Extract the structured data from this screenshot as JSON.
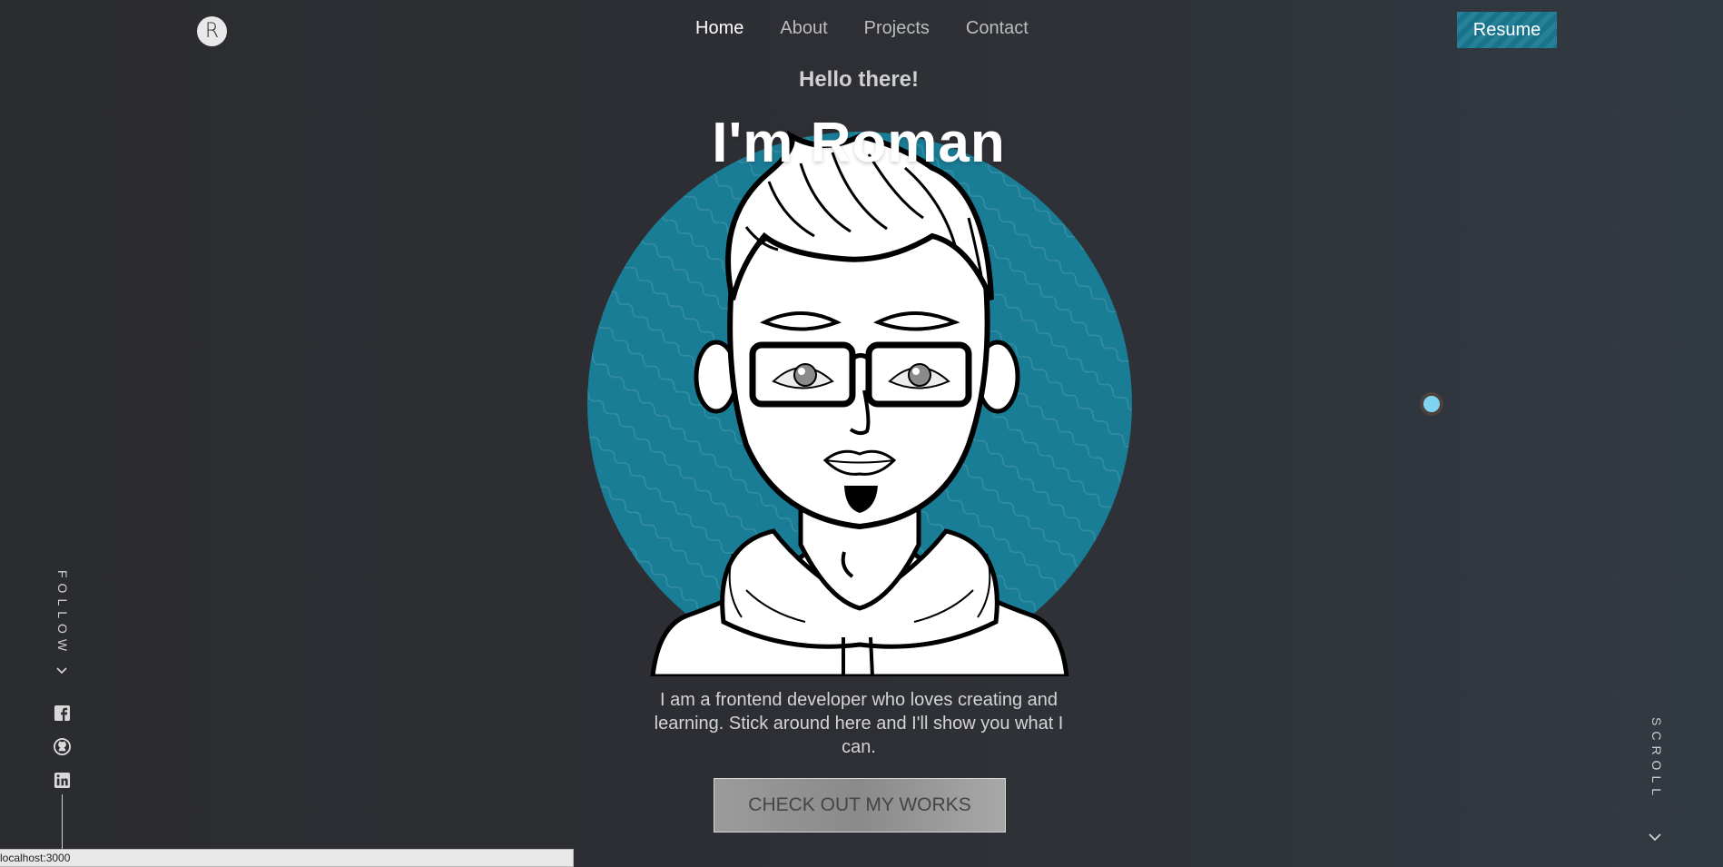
{
  "header": {
    "logo_letter": "R",
    "nav": [
      {
        "label": "Home",
        "active": true
      },
      {
        "label": "About",
        "active": false
      },
      {
        "label": "Projects",
        "active": false
      },
      {
        "label": "Contact",
        "active": false
      }
    ],
    "resume_label": "Resume"
  },
  "hero": {
    "greeting": "Hello there!",
    "title": "I'm Roman",
    "bio": "I am a frontend developer who loves creating and learning. Stick around here and I'll show you what I can.",
    "cta_label": "CHECK OUT MY WORKS"
  },
  "side": {
    "follow_label": "FOLLOW",
    "scroll_label": "SCROLL",
    "socials": [
      "facebook-icon",
      "github-icon",
      "linkedin-icon"
    ]
  },
  "status_bar": {
    "url": "localhost:3000"
  },
  "colors": {
    "accent": "#1a7d96",
    "background": "#2d2f34",
    "text": "#ffffff",
    "nav_inactive": "#bdbdbd"
  }
}
